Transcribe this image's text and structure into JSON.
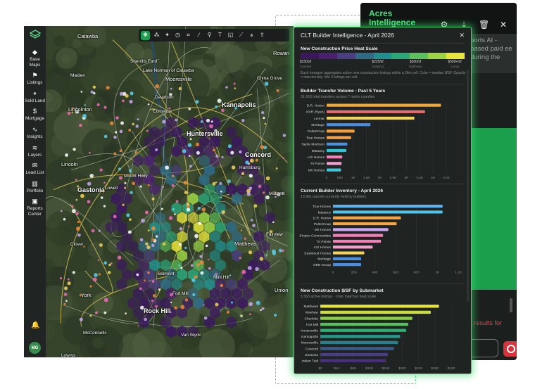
{
  "chat": {
    "title": "Acres Intelligence",
    "snippet": "ports AI -based paid ee during the",
    "footer_text": "ck results for",
    "icons": [
      "gear-icon",
      "download-icon",
      "trash-icon",
      "close-icon"
    ]
  },
  "sidebar": {
    "items": [
      {
        "label": "Base Maps",
        "icon": "◆"
      },
      {
        "label": "Listings",
        "icon": "⚑"
      },
      {
        "label": "Sold Land",
        "icon": "⌖"
      },
      {
        "label": "Mortgage",
        "icon": "$"
      },
      {
        "label": "Insights",
        "icon": "∿"
      },
      {
        "label": "Layers",
        "icon": "≋"
      },
      {
        "label": "Lead List",
        "icon": "✉"
      },
      {
        "label": "Portfolio",
        "icon": "▥"
      },
      {
        "label": "Reports Center",
        "icon": "▣"
      }
    ],
    "avatar": "MG"
  },
  "map": {
    "labels": [
      {
        "text": "Catawba",
        "cls": "mid"
      },
      {
        "text": "Sherrills Ford",
        "cls": ""
      },
      {
        "text": "Rowan",
        "cls": "mid"
      },
      {
        "text": "Maiden",
        "cls": ""
      },
      {
        "text": "Lake Norman of Catawba",
        "cls": ""
      },
      {
        "text": "Mooresville",
        "cls": "mid"
      },
      {
        "text": "China Grove",
        "cls": ""
      },
      {
        "text": "Davidson",
        "cls": ""
      },
      {
        "text": "Kannapolis",
        "cls": "big"
      },
      {
        "text": "Lincolnton",
        "cls": "mid"
      },
      {
        "text": "Cornelius",
        "cls": ""
      },
      {
        "text": "Huntersville",
        "cls": "big"
      },
      {
        "text": "Lincoln",
        "cls": "mid"
      },
      {
        "text": "Concord",
        "cls": "big"
      },
      {
        "text": "Harrisburg",
        "cls": ""
      },
      {
        "text": "Mount Holly",
        "cls": ""
      },
      {
        "text": "Gastonia",
        "cls": "big"
      },
      {
        "text": "Lowell",
        "cls": ""
      },
      {
        "text": "Midland",
        "cls": ""
      },
      {
        "text": "Clover",
        "cls": ""
      },
      {
        "text": "Fairview",
        "cls": ""
      },
      {
        "text": "Matthews",
        "cls": "mid"
      },
      {
        "text": "Belmont",
        "cls": ""
      },
      {
        "text": "Mint Hill",
        "cls": ""
      },
      {
        "text": "Fort Mill",
        "cls": ""
      },
      {
        "text": "York",
        "cls": "mid"
      },
      {
        "text": "Union",
        "cls": "mid"
      },
      {
        "text": "Rock Hill",
        "cls": "big"
      },
      {
        "text": "McConnells",
        "cls": ""
      },
      {
        "text": "Van Wyck",
        "cls": ""
      },
      {
        "text": "Lowrys",
        "cls": ""
      }
    ]
  },
  "toolbar": {
    "tools": [
      "pointer-icon",
      "lasso-icon",
      "person-icon",
      "compass-icon",
      "select-icon",
      "line-icon",
      "pin-icon",
      "text-icon",
      "shape-icon",
      "ruler-icon",
      "measure-icon",
      "upload-icon"
    ],
    "glyphs": [
      "✥",
      "⁂",
      "✦",
      "◷",
      "⌗",
      "∕",
      "⚲",
      "T",
      "◱",
      "⟋",
      "⩚",
      "⇪"
    ]
  },
  "panel": {
    "title": "CLT Builder Intelligence - April 2026",
    "heat": {
      "title": "New Construction Price Heat Scale",
      "colors": [
        "#3b1760",
        "#4a2070",
        "#4a3d83",
        "#2f6b86",
        "#218f8d",
        "#2aa879",
        "#5cc15c",
        "#9dd444",
        "#e6e53a"
      ],
      "ticks": [
        {
          "value": "$150/sf",
          "note": "Cooldest"
        },
        {
          "value": "$225/sf",
          "note": "Gastonia"
        },
        {
          "value": "$300/sf",
          "note": "Matthews"
        },
        {
          "value": "$500+/sf",
          "note": "Luxury"
        }
      ],
      "note": "Each hexagon aggregates active new construction listings within a 2km cell. Color = median $/SF. Opacity = data density. Min 3 listings per cell."
    },
    "transfer": {
      "title": "Builder Transfer Volume - Past 5 Years",
      "subtitle": "31,663 total transfers across 7 metro counties"
    },
    "inventory": {
      "title": "Current Builder Inventory - April 2026",
      "subtitle": "13,961 parcels currently held by builders"
    },
    "psf": {
      "title": "New Construction $/SF by Submarket",
      "subtitle": "1,563 active listings - color matches heat scale"
    }
  },
  "chart_data": [
    {
      "type": "bar",
      "orientation": "horizontal",
      "title": "Builder Transfer Volume - Past 5 Years",
      "categories": [
        "D.R. Horton",
        "NVR (Ryan)",
        "Lennar",
        "Meritage",
        "PulteGroup",
        "True Homes",
        "Taylor Morrison",
        "Mattamy",
        "LGI Homes",
        "Tri Pointe",
        "M/I Homes"
      ],
      "values": [
        4300,
        3700,
        3300,
        1650,
        1050,
        920,
        780,
        740,
        590,
        560,
        540
      ],
      "colors": [
        "#f0a73a",
        "#e56e6e",
        "#f5d25a",
        "#4b8de3",
        "#f59f3a",
        "#f5a04a",
        "#4f8fe0",
        "#2fc3d6",
        "#f27fb5",
        "#f39fd0",
        "#3fc7d8"
      ],
      "xticks": [
        "0",
        "500",
        "1K",
        "1.5K",
        "2K",
        "2.5K",
        "3K",
        "3.5K",
        "4K",
        "4.5K"
      ],
      "xlim": [
        0,
        4500
      ]
    },
    {
      "type": "bar",
      "orientation": "horizontal",
      "title": "Current Builder Inventory - April 2026",
      "categories": [
        "True Homes",
        "Mattamy",
        "D.R. Horton",
        "PulteGroup",
        "M/I Homes",
        "Empire Communities",
        "Tri Pointe",
        "LGI Homes",
        "Eastwood Homes",
        "Meritage",
        "DRB Group"
      ],
      "values": [
        1050,
        1050,
        650,
        610,
        530,
        480,
        460,
        380,
        300,
        270,
        270
      ],
      "colors": [
        "#5fb2f0",
        "#4fc3e8",
        "#f5a443",
        "#f5a443",
        "#c9a8f0",
        "#f27fb5",
        "#f27fb5",
        "#f59fd0",
        "#f5d25a",
        "#4b8de3",
        "#4b8de3"
      ],
      "xticks": [
        "0",
        "200",
        "400",
        "600",
        "800",
        "1K",
        "1.2K"
      ],
      "xlim": [
        0,
        1200
      ]
    },
    {
      "type": "bar",
      "orientation": "horizontal",
      "title": "New Construction $/SF by Submarket",
      "categories": [
        "Matthews",
        "Waxhaw",
        "Charlotte",
        "Fort Mill",
        "Huntersville",
        "Kannapolis",
        "Mooresville",
        "Concord",
        "Gastonia",
        "Indian Trail"
      ],
      "values": [
        290,
        270,
        225,
        215,
        210,
        195,
        190,
        180,
        165,
        160
      ],
      "colors": [
        "#e6e53a",
        "#c9dd3c",
        "#8ccf46",
        "#55c15a",
        "#2fae72",
        "#26998a",
        "#2a7f8c",
        "#3c5a8c",
        "#4a3d83",
        "#4a2f7a"
      ],
      "xticks": [
        "$0",
        "$40",
        "$80",
        "$120",
        "$160",
        "$200",
        "$240",
        "$280",
        "$320"
      ],
      "xlim": [
        0,
        320
      ]
    }
  ]
}
